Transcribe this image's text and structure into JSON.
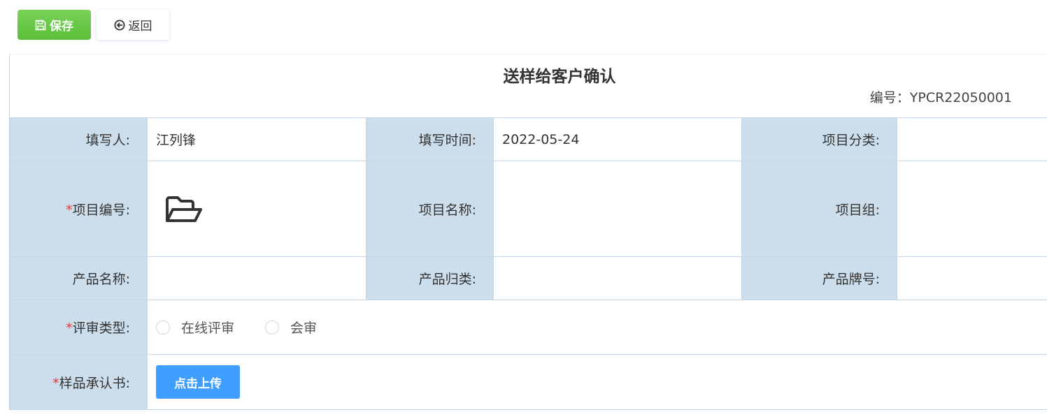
{
  "toolbar": {
    "save_label": "保存",
    "back_label": "返回"
  },
  "form": {
    "title": "送样给客户确认",
    "code_label": "编号：",
    "code_value": "YPCR22050001",
    "required_mark": "*",
    "fields": {
      "filler_label": "填写人:",
      "filler_value": "江列锋",
      "fill_time_label": "填写时间:",
      "fill_time_value": "2022-05-24",
      "project_category_label": "项目分类:",
      "project_category_value": "",
      "project_no_label": "项目编号:",
      "project_name_label": "项目名称:",
      "project_name_value": "",
      "project_group_label": "项目组:",
      "project_group_value": "",
      "product_name_label": "产品名称:",
      "product_name_value": "",
      "product_class_label": "产品归类:",
      "product_class_value": "",
      "product_brand_label": "产品牌号:",
      "product_brand_value": "",
      "review_type_label": "评审类型:",
      "review_options": [
        "在线评审",
        "会审"
      ],
      "sample_letter_label": "样品承认书:",
      "upload_label": "点击上传"
    }
  },
  "colors": {
    "save_button": "#67c23a",
    "upload_button": "#409eff",
    "label_cell": "#ccdeeb",
    "border": "#c5d6e6",
    "required": "#e53935"
  },
  "icons": {
    "save": "floppy-disk-icon",
    "back": "arrow-left-circle-icon",
    "project_lookup": "folder-open-icon"
  }
}
